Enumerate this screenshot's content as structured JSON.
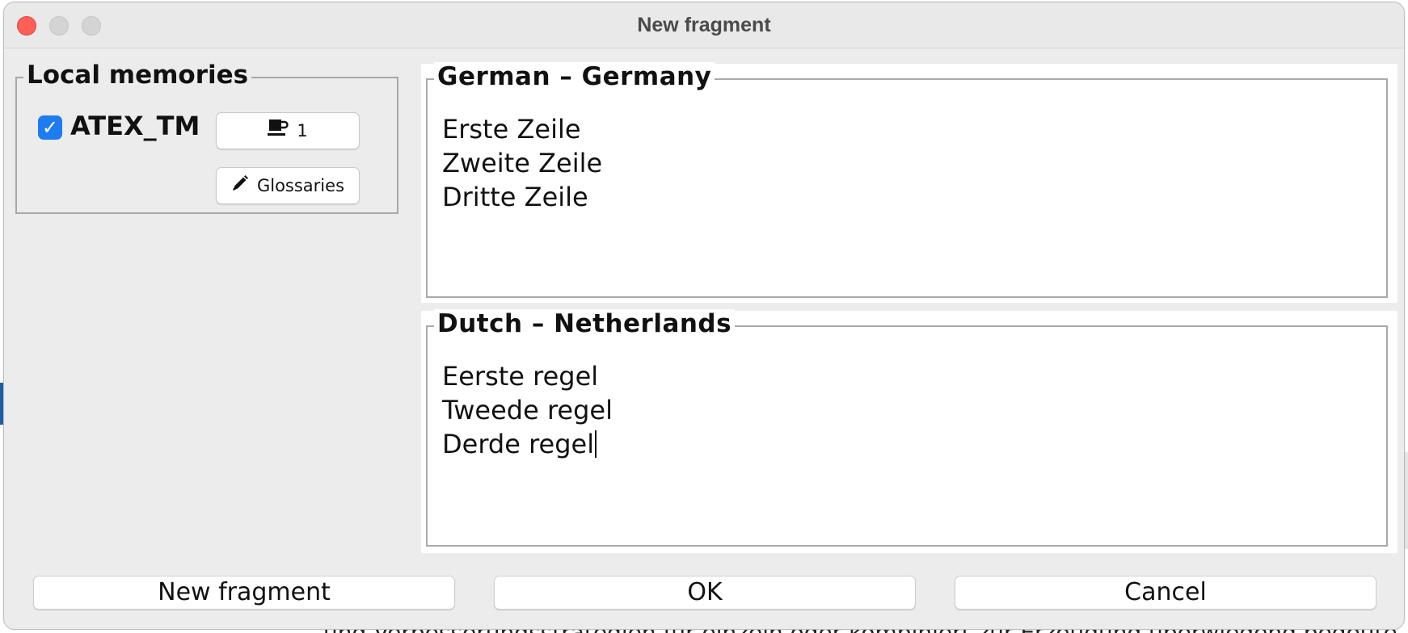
{
  "window": {
    "title": "New fragment"
  },
  "local_memories": {
    "label": "Local memories",
    "items": [
      {
        "name": "ATEX_TM",
        "checked": true,
        "count_label": "1",
        "count_icon": "coffee-cup-icon"
      }
    ],
    "glossaries_label": "Glossaries",
    "glossaries_icon": "pencil-icon"
  },
  "source": {
    "language": "German – Germany",
    "lines": [
      "Erste Zeile",
      "Zweite Zeile",
      "Dritte Zeile"
    ]
  },
  "target": {
    "language": "Dutch – Netherlands",
    "lines": [
      "Eerste regel",
      "Tweede regel",
      "Derde regel"
    ]
  },
  "buttons": {
    "new_fragment": "New fragment",
    "ok": "OK",
    "cancel": "Cancel"
  },
  "background": {
    "bottom_text": "und Verbesserungsstrategien für einzeln oder kombiniert zur Erzeugung überwiegend bedeutend"
  },
  "colors": {
    "close": "#fe5f57",
    "checkbox": "#1e7cf2",
    "window_bg": "#ececec"
  }
}
